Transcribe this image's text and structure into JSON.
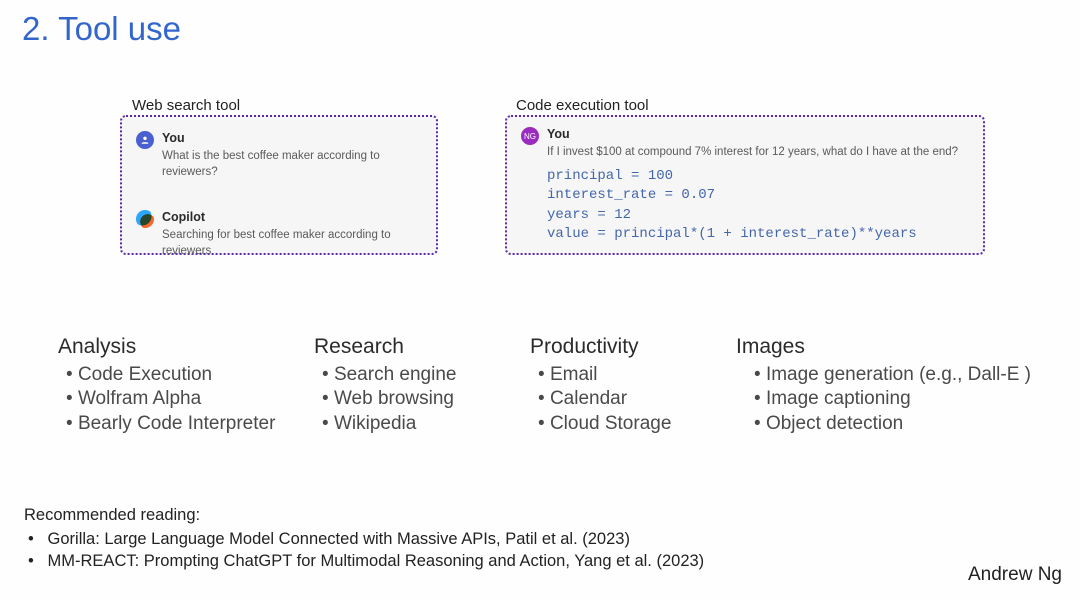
{
  "title": "2. Tool use",
  "panels": {
    "left": {
      "label": "Web search tool",
      "user_label": "You",
      "user_msg": "What is the best coffee maker according to reviewers?",
      "agent_label": "Copilot",
      "agent_msg": "Searching for best coffee maker according to reviewers"
    },
    "right": {
      "label": "Code execution tool",
      "user_badge": "NG",
      "user_label": "You",
      "user_msg": "If I invest $100 at compound 7% interest for 12 years, what do I have at the end?",
      "code": "principal = 100\ninterest_rate = 0.07\nyears = 12\nvalue = principal*(1 + interest_rate)**years"
    }
  },
  "categories": [
    {
      "title": "Analysis",
      "items": [
        "Code Execution",
        "Wolfram Alpha",
        "Bearly Code Interpreter"
      ]
    },
    {
      "title": "Research",
      "items": [
        "Search engine",
        "Web browsing",
        "Wikipedia"
      ]
    },
    {
      "title": "Productivity",
      "items": [
        "Email",
        "Calendar",
        "Cloud Storage"
      ]
    },
    {
      "title": "Images",
      "items": [
        "Image generation (e.g., Dall-E )",
        "Image captioning",
        "Object detection"
      ]
    }
  ],
  "footer": {
    "heading": "Recommended reading:",
    "items": [
      "Gorilla: Large Language Model Connected with Massive APIs, Patil et al. (2023)",
      "MM-REACT: Prompting ChatGPT for Multimodal Reasoning and Action, Yang et al. (2023)"
    ]
  },
  "author": "Andrew Ng"
}
